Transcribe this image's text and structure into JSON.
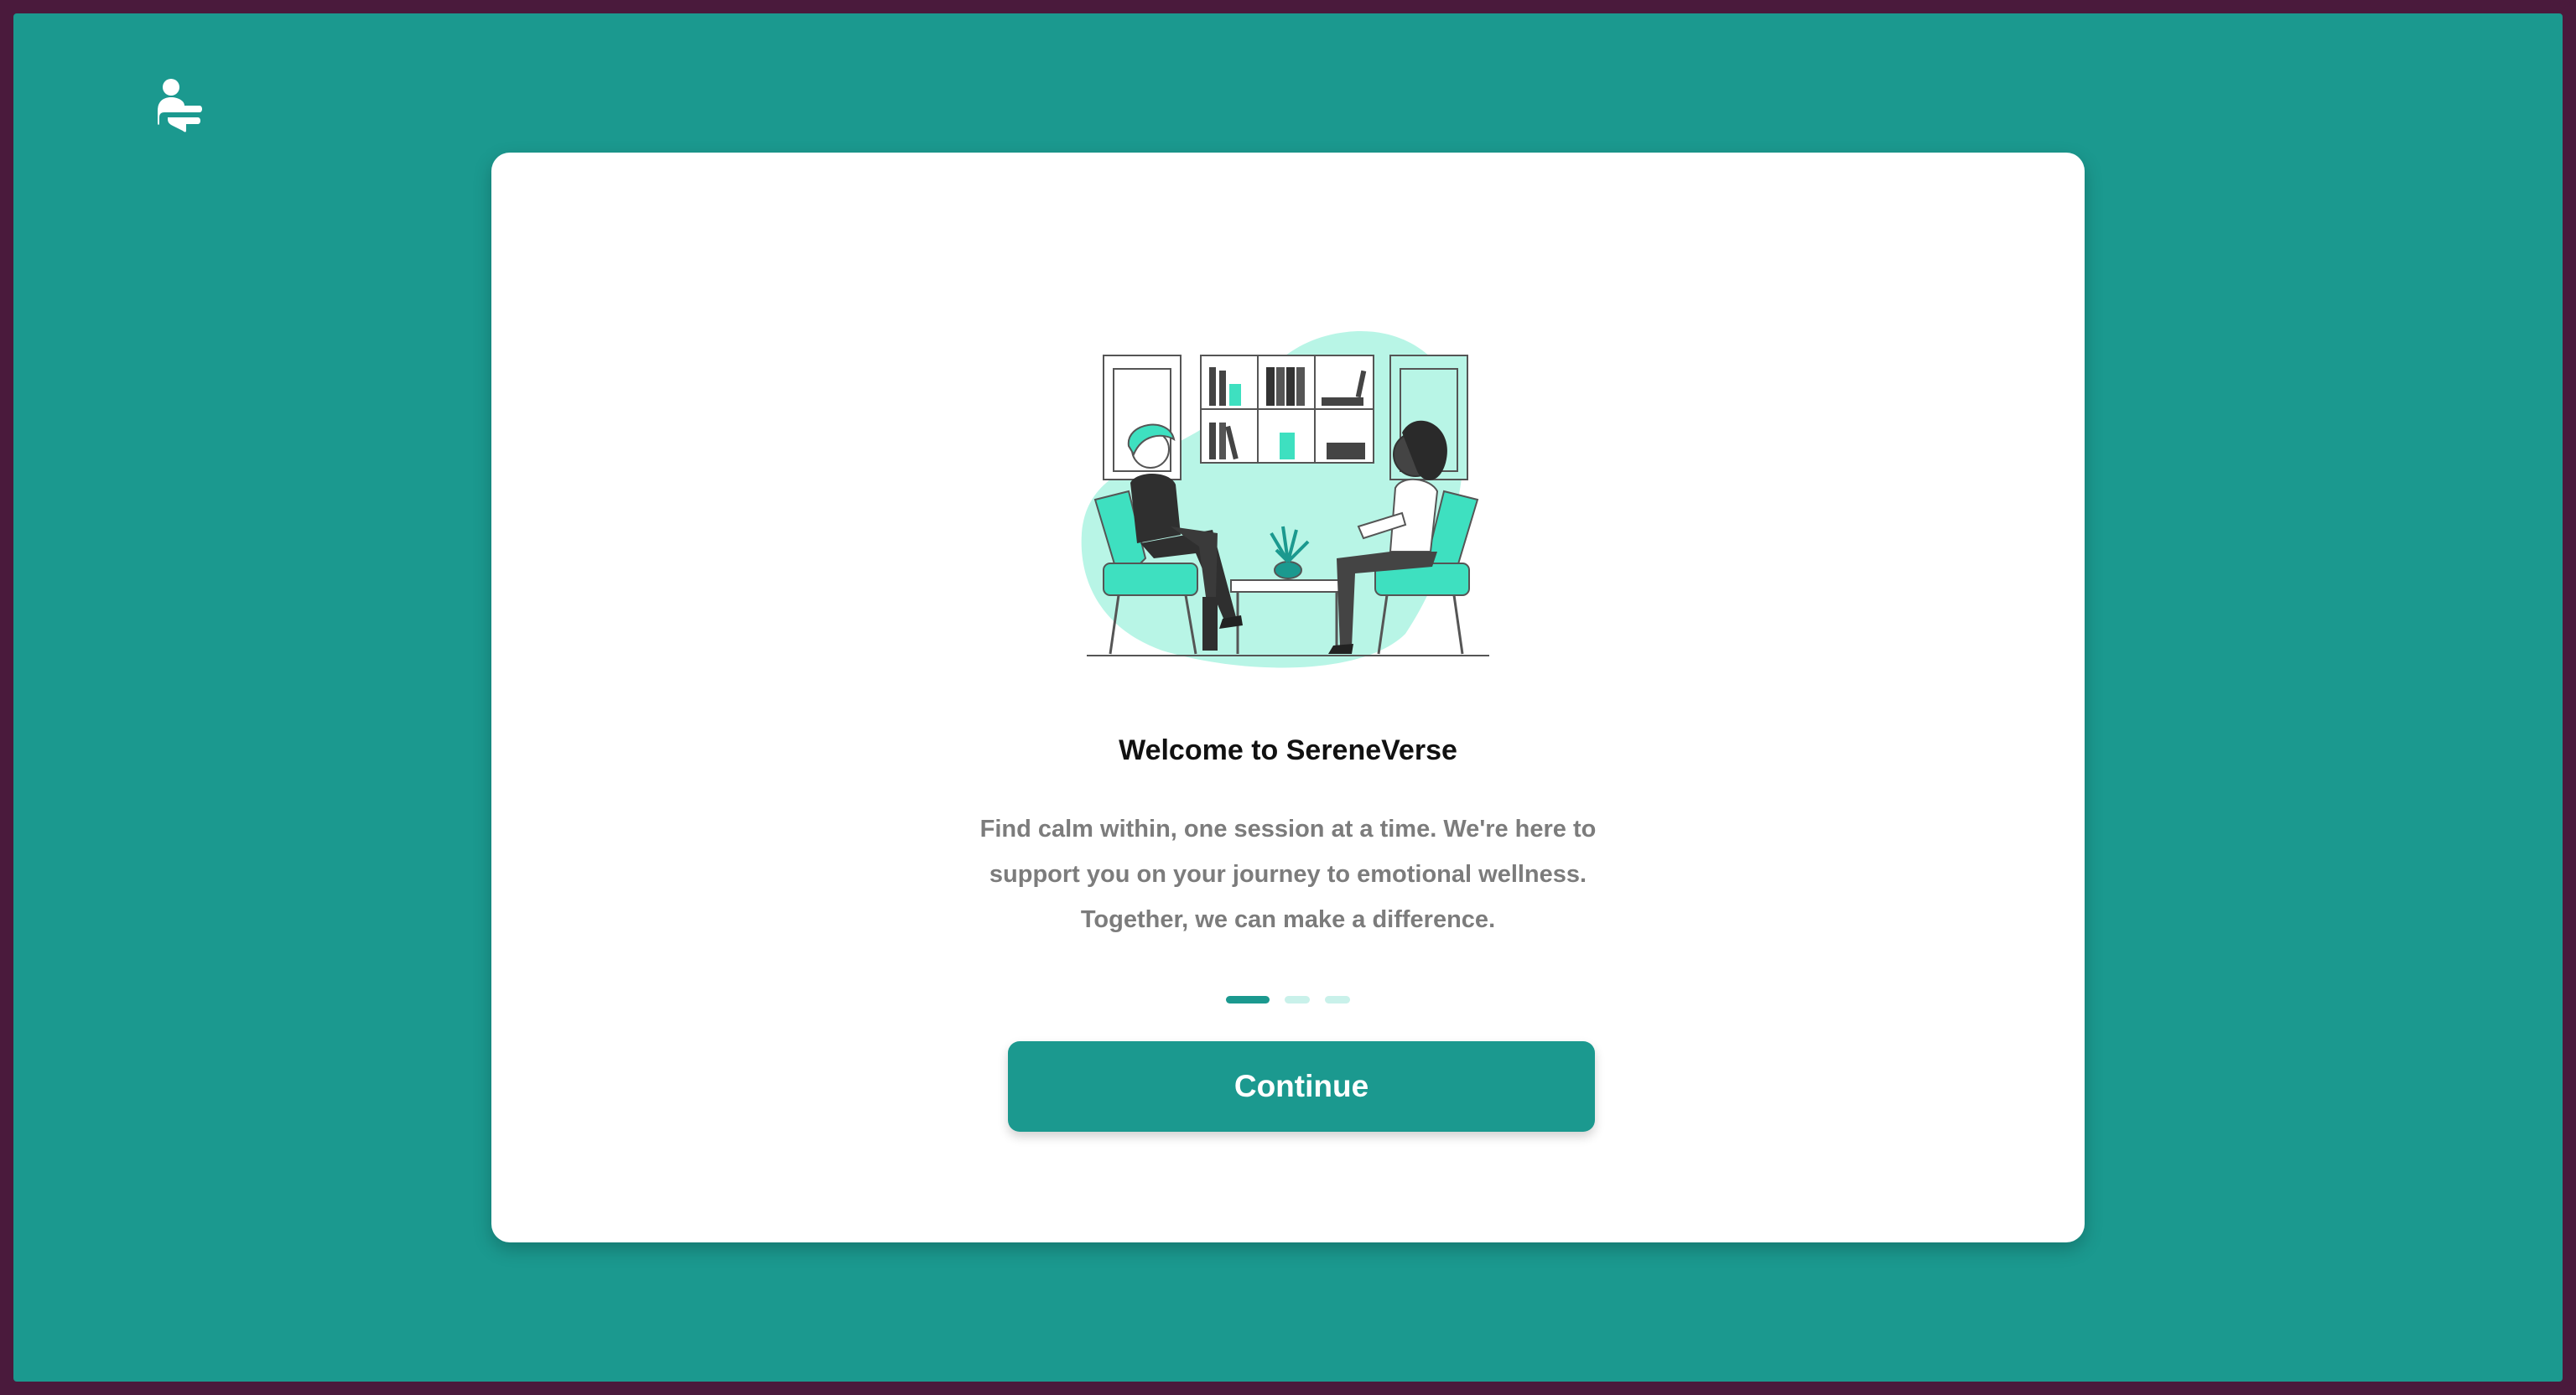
{
  "app": {
    "logo_icon": "person-logo-icon",
    "colors": {
      "background_outer": "#4a1a3c",
      "primary": "#1b998f",
      "accent_light": "#c9f1ea",
      "illustration_blob": "#b8f5e6",
      "illustration_accent": "#3ee0c0"
    }
  },
  "onboarding": {
    "illustration_icon": "therapy-session-illustration",
    "title": "Welcome to SereneVerse",
    "description_lines": [
      "Find calm within, one session at a time. We're here to",
      "support you on your journey to emotional wellness.",
      "Together, we can make a difference."
    ],
    "pagination": {
      "total_steps": 3,
      "current_step": 1
    },
    "continue_label": "Continue"
  }
}
